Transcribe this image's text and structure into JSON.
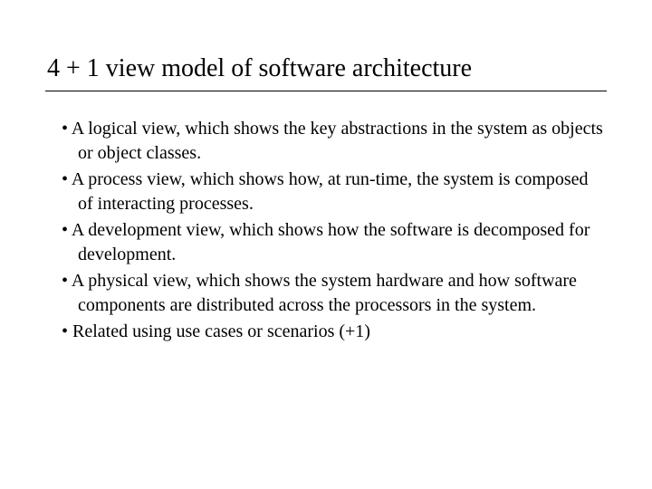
{
  "title": "4 + 1 view model of software architecture",
  "bullets": [
    "A logical view, which shows the key abstractions in the system as objects or object classes.",
    "A process view, which shows how, at run-time, the system is composed of interacting processes.",
    "A development view, which shows how the software is decomposed for development.",
    "A physical view, which shows the system hardware and how software components are distributed across the processors in the system.",
    "Related using use cases or scenarios (+1)"
  ]
}
